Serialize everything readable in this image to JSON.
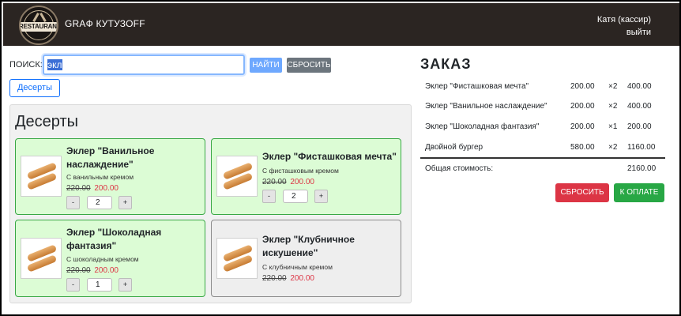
{
  "header": {
    "logo_text": "RESTAURANT",
    "brand": "GRAФ КУТУЗOFF",
    "user_name": "Катя (кассир)",
    "logout": "выйти"
  },
  "search": {
    "label": "ПОИСК:",
    "value": "экл",
    "find_button": "НАЙТИ",
    "reset_button": "СБРОСИТЬ"
  },
  "category_filter": "Десерты",
  "catalog": {
    "title": "Десерты",
    "products": [
      {
        "name": "Эклер \"Ванильное наслаждение\"",
        "desc": "С ванильным кремом",
        "old_price": "220.00",
        "new_price": "200.00",
        "qty": "2"
      },
      {
        "name": "Эклер \"Фисташковая мечта\"",
        "desc": "С фисташковым кремом",
        "old_price": "220.00",
        "new_price": "200.00",
        "qty": "2"
      },
      {
        "name": "Эклер \"Шоколадная фантазия\"",
        "desc": "С шоколадным кремом",
        "old_price": "220.00",
        "new_price": "200.00",
        "qty": "1"
      },
      {
        "name": "Эклер \"Клубничное искушение\"",
        "desc": "С клубничным кремом",
        "old_price": "220.00",
        "new_price": "200.00"
      }
    ],
    "minus": "-",
    "plus": "+"
  },
  "order": {
    "title": "ЗАКАЗ",
    "items": [
      {
        "name": "Эклер \"Фисташковая мечта\"",
        "price": "200.00",
        "qty": "×2",
        "sum": "400.00"
      },
      {
        "name": "Эклер \"Ванильное наслаждение\"",
        "price": "200.00",
        "qty": "×2",
        "sum": "400.00"
      },
      {
        "name": "Эклер \"Шоколадная фантазия\"",
        "price": "200.00",
        "qty": "×1",
        "sum": "200.00"
      },
      {
        "name": "Двойной бургер",
        "price": "580.00",
        "qty": "×2",
        "sum": "1160.00"
      }
    ],
    "total_label": "Общая стоимость:",
    "total": "2160.00",
    "clear_button": "СБРОСИТЬ",
    "pay_button": "К ОПЛАТЕ"
  },
  "colors": {
    "header_bg": "#2b2522",
    "active_card_bg": "#dcfcd5",
    "active_card_border": "#39a845",
    "price_red": "#dc3545",
    "pay_green": "#28a745",
    "primary_blue": "#0d6efd"
  }
}
